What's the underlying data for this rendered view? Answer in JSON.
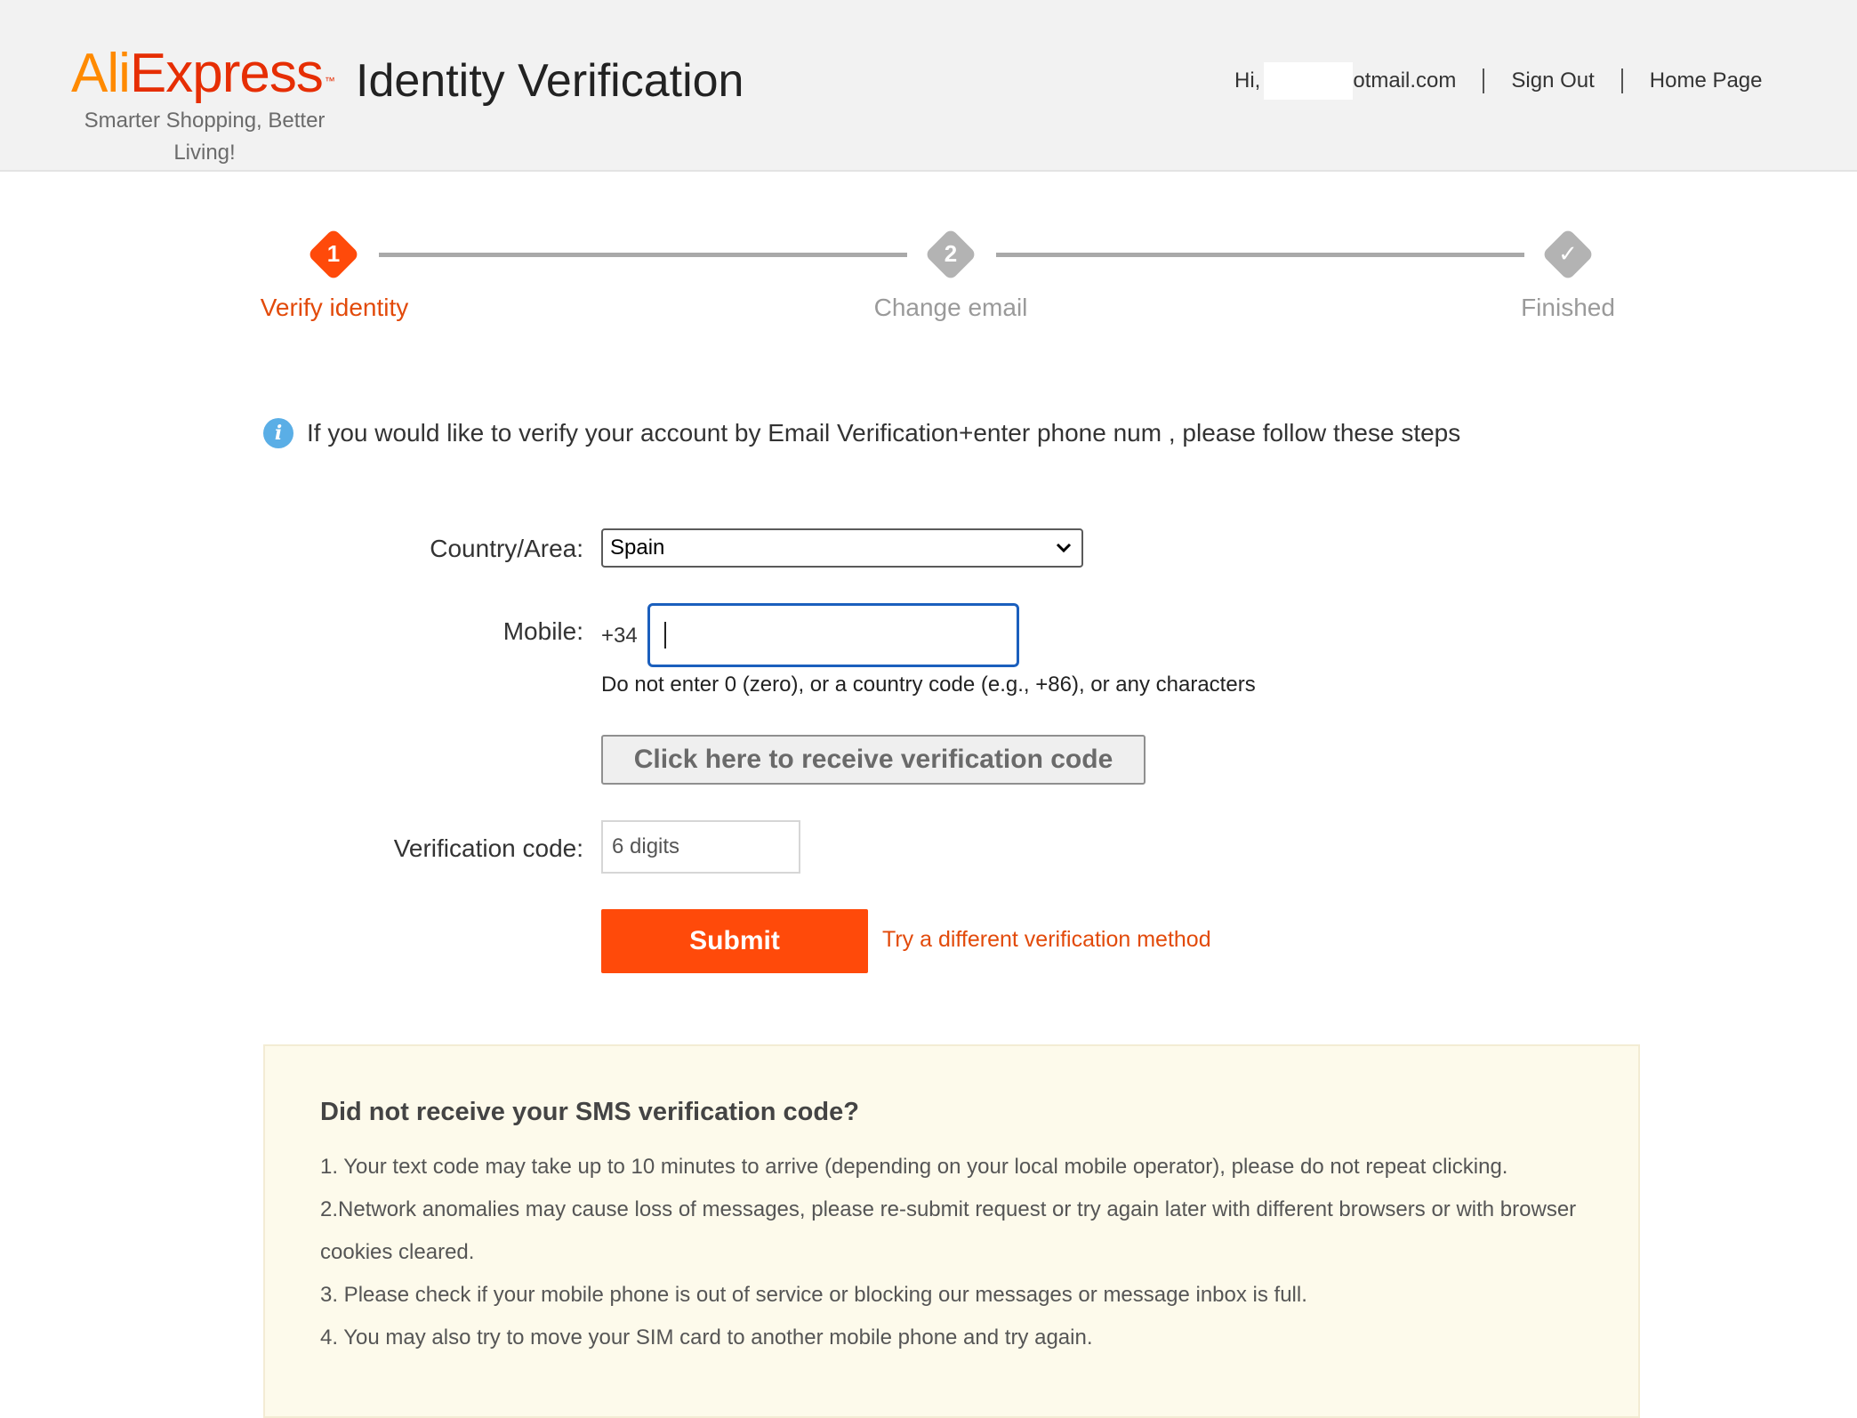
{
  "header": {
    "logo_part1": "Ali",
    "logo_part2": "Express",
    "logo_tm": "™",
    "tagline": "Smarter Shopping, Better Living!",
    "title": "Identity Verification",
    "greeting": "Hi,",
    "email_visible_fragment": "otmail.com",
    "sign_out": "Sign Out",
    "home_page": "Home Page"
  },
  "steps": [
    {
      "number": "1",
      "label": "Verify identity",
      "state": "active"
    },
    {
      "number": "2",
      "label": "Change email",
      "state": "inactive"
    },
    {
      "number": "✓",
      "label": "Finished",
      "state": "inactive"
    }
  ],
  "info": {
    "icon": "info-icon",
    "text": "If you would like to verify your account by Email Verification+enter phone num , please follow these steps"
  },
  "form": {
    "country_label": "Country/Area:",
    "country_value": "Spain",
    "mobile_label": "Mobile:",
    "mobile_prefix": "+34",
    "mobile_value": "",
    "mobile_hint": "Do not enter 0 (zero), or a country code (e.g., +86), or any characters",
    "code_button": "Click here to receive verification code",
    "verification_label": "Verification code:",
    "verification_placeholder": "6 digits",
    "submit": "Submit",
    "alt_method": "Try a different verification method"
  },
  "help": {
    "title": "Did not receive your SMS verification code?",
    "items": [
      "1. Your text code may take up to 10 minutes to arrive (depending on your local mobile operator), please do not repeat clicking.",
      "2.Network anomalies may cause loss of messages, please re-submit request or try again later with different browsers or with browser cookies cleared.",
      "3. Please check if your mobile phone is out of service or blocking our messages or message inbox is full.",
      "4. You may also try to move your SIM card to another mobile phone and try again."
    ]
  },
  "colors": {
    "accent": "#ff4a0a",
    "active_step": "#ff4a0a",
    "inactive_step": "#b3b3b3",
    "info_blue": "#5aaee6",
    "help_bg": "#fdfaeb"
  }
}
